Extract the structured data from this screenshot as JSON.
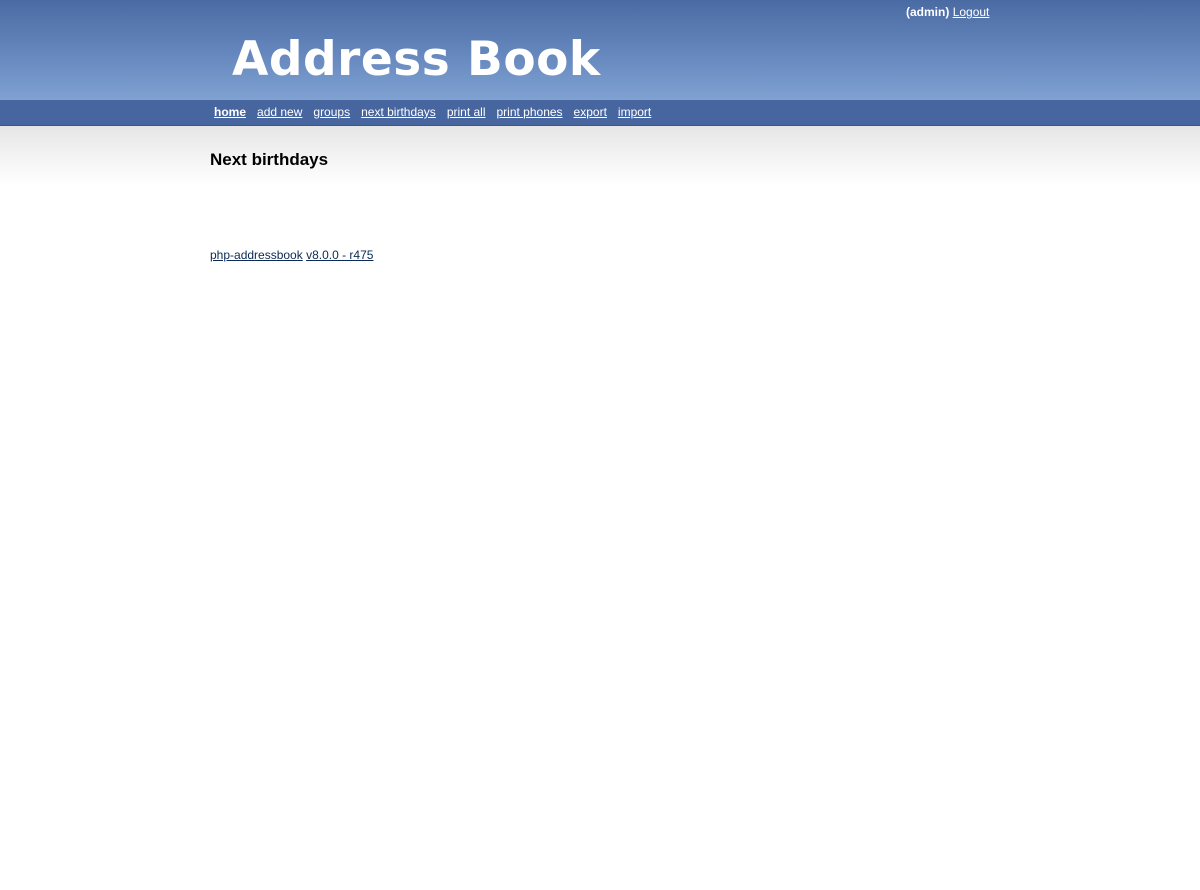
{
  "header": {
    "user": "(admin)",
    "logout_label": "Logout",
    "logo_text": "Address Book"
  },
  "nav": {
    "items": [
      {
        "label": "home"
      },
      {
        "label": "add new"
      },
      {
        "label": "groups"
      },
      {
        "label": "next birthdays"
      },
      {
        "label": "print all"
      },
      {
        "label": "print phones"
      },
      {
        "label": "export"
      },
      {
        "label": "import"
      }
    ]
  },
  "main": {
    "title": "Next birthdays"
  },
  "footer": {
    "app_link": "php-addressbook",
    "version_link": "v8.0.0 - r475"
  },
  "colors": {
    "header_top": "#4a6aa3",
    "header_bottom": "#7fa2d2",
    "nav_bg": "#4766a0",
    "footer_link": "#0c2a56"
  }
}
